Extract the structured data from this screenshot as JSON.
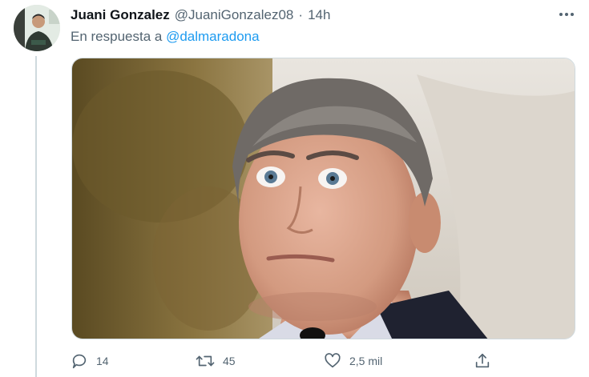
{
  "tweet": {
    "author_name": "Juani Gonzalez",
    "author_handle": "@JuaniGonzalez08",
    "separator": "·",
    "time": "14h",
    "reply_prefix": "En respuesta a ",
    "reply_to": "@dalmaradona"
  },
  "actions": {
    "replies": "14",
    "retweets": "45",
    "likes": "2,5 mil"
  },
  "icons": {
    "reply": "reply-icon",
    "retweet": "retweet-icon",
    "like": "heart-icon",
    "share": "share-icon",
    "more": "more-icon"
  },
  "colors": {
    "link": "#1d9bf0",
    "secondary_text": "#536471",
    "primary_text": "#0f1419"
  }
}
